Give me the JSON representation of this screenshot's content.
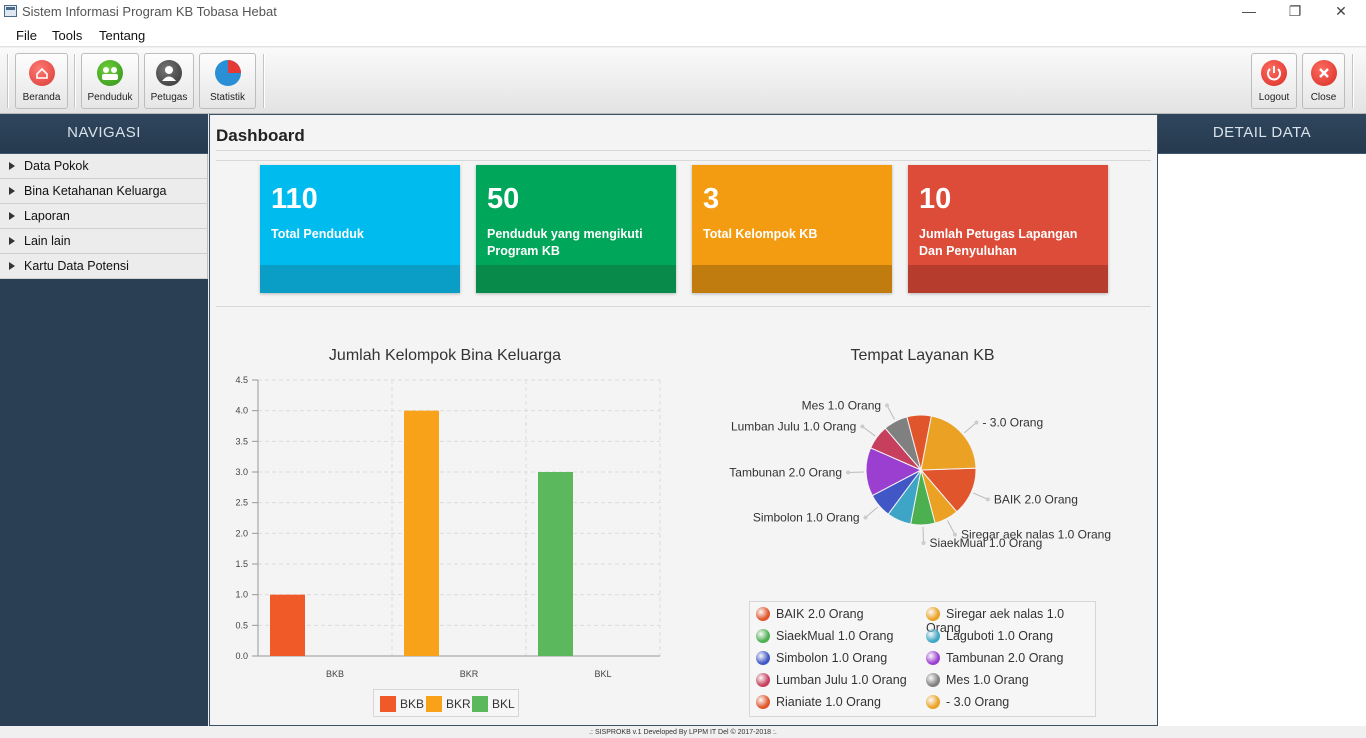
{
  "window": {
    "title": "Sistem Informasi Program KB Tobasa Hebat",
    "minimize": "—",
    "maximize": "❐",
    "close": "✕"
  },
  "menu": [
    "File",
    "Tools",
    "Tentang"
  ],
  "toolbar": {
    "beranda": "Beranda",
    "penduduk": "Penduduk",
    "petugas": "Petugas",
    "statistik": "Statistik",
    "logout": "Logout",
    "close": "Close"
  },
  "left_panel": {
    "header": "NAVIGASI",
    "items": [
      "Data Pokok",
      "Bina Ketahanan Keluarga",
      "Laporan",
      "Lain lain",
      "Kartu Data Potensi"
    ]
  },
  "right_panel": {
    "header": "DETAIL DATA"
  },
  "dashboard": {
    "title": "Dashboard",
    "cards": [
      {
        "value": "110",
        "label": "Total Penduduk",
        "color": "#00bcee",
        "foot": "#0a9ec6"
      },
      {
        "value": "50",
        "label": "Penduduk yang mengikuti\nProgram KB",
        "color": "#00a65a",
        "foot": "#078a4a"
      },
      {
        "value": "3",
        "label": "Total Kelompok KB",
        "color": "#f39c12",
        "foot": "#c17c10"
      },
      {
        "value": "10",
        "label": "Jumlah Petugas Lapangan\n Dan Penyuluhan",
        "color": "#dd4b39",
        "foot": "#b63d2e"
      }
    ]
  },
  "chart_data": [
    {
      "type": "bar",
      "title": "Jumlah Kelompok Bina Keluarga",
      "categories": [
        "BKB",
        "BKR",
        "BKL"
      ],
      "series": [
        {
          "name": "BKB",
          "color": "#f05a28",
          "values": [
            1.0,
            null,
            null
          ]
        },
        {
          "name": "BKR",
          "color": "#f8a21a",
          "values": [
            null,
            4.0,
            null
          ]
        },
        {
          "name": "BKL",
          "color": "#5cb85c",
          "values": [
            null,
            null,
            3.0
          ]
        }
      ],
      "ylim": [
        0,
        4.5
      ],
      "yticks": [
        "0.0",
        "0.5",
        "1.0",
        "1.5",
        "2.0",
        "2.5",
        "3.0",
        "3.5",
        "4.0",
        "4.5"
      ],
      "grid": true,
      "legend": "bottom"
    },
    {
      "type": "pie",
      "title": "Tempat Layanan KB",
      "slices": [
        {
          "label": "BAIK 2.0 Orang",
          "value": 2,
          "color": "#e0552c"
        },
        {
          "label": "Siregar aek nalas 1.0 Orang",
          "value": 1,
          "color": "#eba224"
        },
        {
          "label": "SiaekMual 1.0 Orang",
          "value": 1,
          "color": "#4caf50"
        },
        {
          "label": "Laguboti 1.0 Orang",
          "value": 1,
          "color": "#3ea5c6"
        },
        {
          "label": "Simbolon 1.0 Orang",
          "value": 1,
          "color": "#4057c5"
        },
        {
          "label": "Tambunan 2.0 Orang",
          "value": 2,
          "color": "#9b3fd0"
        },
        {
          "label": "Lumban Julu 1.0 Orang",
          "value": 1,
          "color": "#c6405e"
        },
        {
          "label": "Mes 1.0 Orang",
          "value": 1,
          "color": "#808080"
        },
        {
          "label": "Rianiate 1.0 Orang",
          "value": 1,
          "color": "#e0552c"
        },
        {
          "label": "- 3.0 Orang",
          "value": 3,
          "color": "#eba224"
        }
      ],
      "callouts": [
        "- 3.0 Orang",
        "BAIK 2.0 Orang",
        "Siregar aek nalas 1.0 Orang",
        "SiaekMual 1.0 Orang",
        "Simbolon 1.0 Orang",
        "Tambunan 2.0 Orang",
        "Lumban Julu 1.0 Orang",
        "Mes 1.0 Orang"
      ],
      "legend": "bottom"
    }
  ],
  "status": ".: SISPROKB v.1 Developed By LPPM IT Del © 2017-2018 :."
}
